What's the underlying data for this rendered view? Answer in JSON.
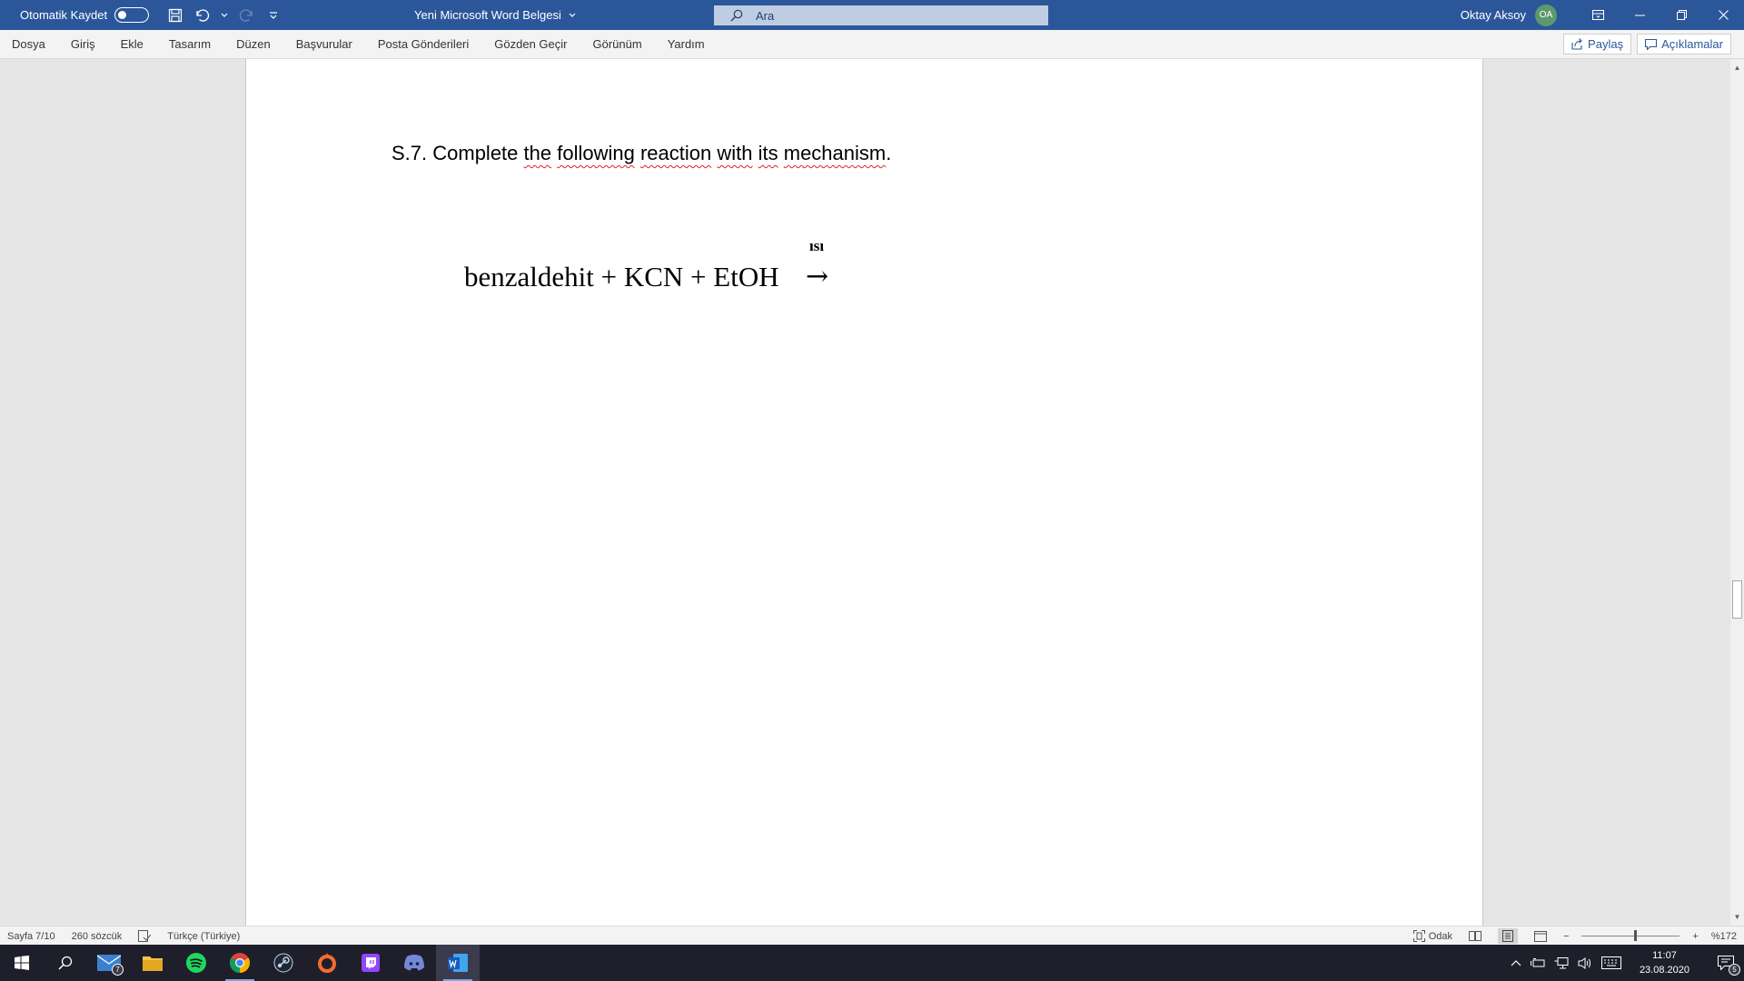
{
  "titlebar": {
    "autosave_label": "Otomatik Kaydet",
    "document_title": "Yeni Microsoft Word Belgesi",
    "search_placeholder": "Ara",
    "user_name": "Oktay Aksoy",
    "user_initials": "OA"
  },
  "ribbon": {
    "tabs": [
      "Dosya",
      "Giriş",
      "Ekle",
      "Tasarım",
      "Düzen",
      "Başvurular",
      "Posta Gönderileri",
      "Gözden Geçir",
      "Görünüm",
      "Yardım"
    ],
    "share_label": "Paylaş",
    "comments_label": "Açıklamalar"
  },
  "document": {
    "question_prefix": "S.7. Complete ",
    "question_words": [
      "the",
      " ",
      "following",
      " ",
      "reaction",
      " ",
      "with",
      " ",
      "its",
      " ",
      "mechanism"
    ],
    "question_suffix": ".",
    "reaction_text": "benzaldehit + KCN + EtOH",
    "reaction_condition": "ısı",
    "reaction_arrow": "→"
  },
  "statusbar": {
    "page_info": "Sayfa 7/10",
    "word_count": "260 sözcük",
    "language": "Türkçe (Türkiye)",
    "focus_label": "Odak",
    "zoom_level": "%172"
  },
  "taskbar": {
    "time": "11:07",
    "date": "23.08.2020",
    "notification_count": "5",
    "mail_badge": "7"
  },
  "colors": {
    "word_blue": "#2b579a",
    "spellcheck_red": "#d22222"
  }
}
